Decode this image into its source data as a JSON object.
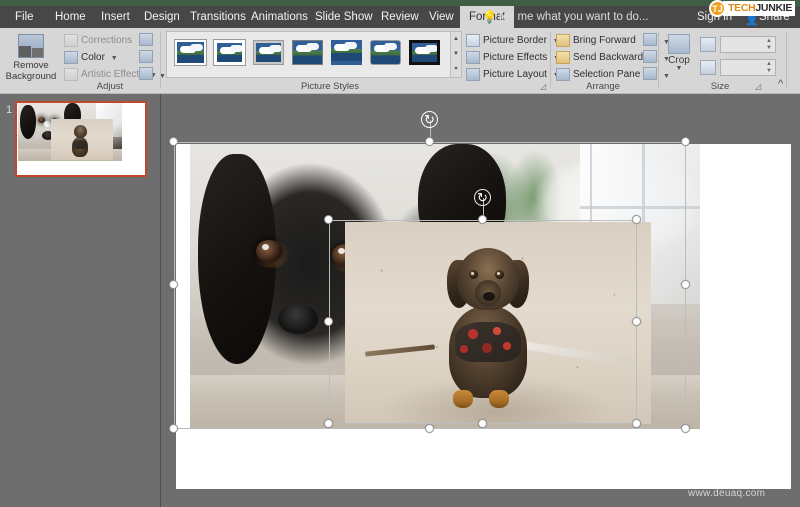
{
  "app": {
    "title_bar_color": "#3e5f45",
    "ribbon_bg": "#d6d6d6",
    "canvas_bg": "#6e6e6e",
    "selection_accent": "#c0482a"
  },
  "tabs": [
    {
      "label": "File",
      "active": false
    },
    {
      "label": "Home",
      "active": false
    },
    {
      "label": "Insert",
      "active": false
    },
    {
      "label": "Design",
      "active": false
    },
    {
      "label": "Transitions",
      "active": false
    },
    {
      "label": "Animations",
      "active": false
    },
    {
      "label": "Slide Show",
      "active": false
    },
    {
      "label": "Review",
      "active": false
    },
    {
      "label": "View",
      "active": false
    },
    {
      "label": "Format",
      "active": true
    }
  ],
  "tellme": {
    "placeholder": "Tell me what you want to do...",
    "icon": "lightbulb-icon"
  },
  "account": {
    "sign_in": "Sign in",
    "share": "Share",
    "share_icon": "share-person-icon"
  },
  "watermark_logo": {
    "badge": "TJ",
    "word_a": "TECH",
    "word_b": "JUNKIE"
  },
  "ribbon": {
    "groups": [
      {
        "name": "Adjust",
        "label": "Adjust"
      },
      {
        "name": "Picture Styles",
        "label": "Picture Styles"
      },
      {
        "name": "Arrange",
        "label": "Arrange"
      },
      {
        "name": "Size",
        "label": "Size"
      }
    ],
    "adjust": {
      "remove_background": "Remove\nBackground",
      "remove_background_line1": "Remove",
      "remove_background_line2": "Background",
      "corrections": "Corrections",
      "color": "Color",
      "artistic_effects": "Artistic Effects",
      "compress_pictures_icon": "compress-pictures-icon",
      "change_picture_icon": "change-picture-icon",
      "reset_picture_icon": "reset-picture-icon"
    },
    "picture_styles": {
      "gallery_label": "Picture Styles",
      "thumbnails": [
        "simple-frame-white",
        "beveled-matte-white",
        "metal-frame",
        "drop-shadow-rectangle",
        "reflected-rounded-rectangle",
        "soft-edge-oval",
        "black-thick-frame"
      ],
      "picture_border": "Picture Border",
      "picture_effects": "Picture Effects",
      "picture_layout": "Picture Layout"
    },
    "arrange": {
      "bring_forward": "Bring Forward",
      "send_backward": "Send Backward",
      "selection_pane": "Selection Pane",
      "align_icon": "align-objects-icon",
      "group_icon": "group-objects-icon",
      "rotate_icon": "rotate-objects-icon"
    },
    "size": {
      "crop": "Crop",
      "height_value": "",
      "width_value": "",
      "height_icon": "shape-height-icon",
      "width_icon": "shape-width-icon"
    },
    "collapse_icon": "chevron-up-icon",
    "dialog_launcher_icon": "dialog-launcher-icon"
  },
  "thumbnails": {
    "slides": [
      {
        "number": "1",
        "selected": true
      }
    ]
  },
  "slide": {
    "images": [
      {
        "name": "back-photo-black-dachshund",
        "selected": true,
        "rotation_handle": "rotate-handle-icon"
      },
      {
        "name": "front-photo-dapple-dachshund",
        "selected": true,
        "rotation_handle": "rotate-handle-icon"
      }
    ]
  },
  "site_watermark": "www.deuaq.com"
}
